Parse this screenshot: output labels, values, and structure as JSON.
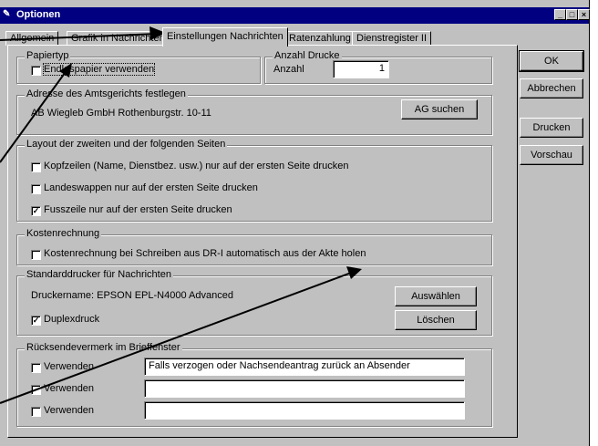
{
  "window": {
    "title": "Optionen",
    "minimize_glyph": "_",
    "maximize_glyph": "□",
    "close_glyph": "×",
    "app_icon": "pen-icon"
  },
  "tabs": [
    {
      "label": "Allgemein"
    },
    {
      "label": "Grafik in Nachrichten"
    },
    {
      "label": "Einstellungen Nachrichten"
    },
    {
      "label": "Ratenzahlung"
    },
    {
      "label": "Dienstregister II"
    }
  ],
  "active_tab": "Einstellungen Nachrichten",
  "papiertyp": {
    "legend": "Papiertyp",
    "checkbox_label": "Endlospapier verwenden",
    "checked": false
  },
  "anzahl": {
    "legend": "Anzahl Drucke",
    "label": "Anzahl",
    "value": "1"
  },
  "amtsgericht": {
    "legend": "Adresse des Amtsgerichts festlegen",
    "address": "AB Wiegleb GmbH  Rothenburgstr. 10-11",
    "button": "AG suchen"
  },
  "layout": {
    "legend": "Layout der zweiten und der folgenden Seiten",
    "options": [
      {
        "label": "Kopfzeilen (Name, Dienstbez. usw.) nur auf der ersten Seite drucken",
        "checked": false
      },
      {
        "label": "Landeswappen nur auf der ersten Seite drucken",
        "checked": false
      },
      {
        "label": "Fusszeile nur auf der ersten Seite drucken",
        "checked": true
      }
    ]
  },
  "kosten": {
    "legend": "Kostenrechnung",
    "checkbox_label": "Kostenrechnung bei Schreiben aus DR-I automatisch aus der Akte holen",
    "checked": false
  },
  "drucker": {
    "legend": "Standarddrucker für Nachrichten",
    "printer_name": "Druckername: EPSON EPL-N4000 Advanced",
    "duplex_label": "Duplexdruck",
    "duplex_checked": true,
    "select_button": "Auswählen",
    "delete_button": "Löschen"
  },
  "ruecksende": {
    "legend": "Rücksendevermerk im Brieffenster",
    "rows": [
      {
        "label": "Verwenden",
        "checked": false,
        "value": "Falls verzogen oder Nachsendeantrag zurück an Absender"
      },
      {
        "label": "Verwenden",
        "checked": false,
        "value": ""
      },
      {
        "label": "Verwenden",
        "checked": false,
        "value": ""
      }
    ]
  },
  "side_buttons": {
    "ok": "OK",
    "cancel": "Abbrechen",
    "print": "Drucken",
    "preview": "Vorschau"
  },
  "check_glyph": "✓",
  "arrow_color": "#000000"
}
